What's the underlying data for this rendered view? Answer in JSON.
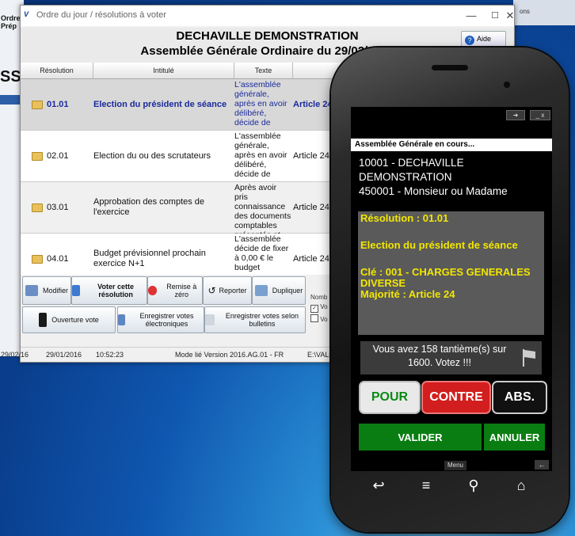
{
  "background_app": {
    "left_label1": "Ordre",
    "left_label2": "Prép",
    "left_big": "SSC",
    "top_right": "ons"
  },
  "window": {
    "title": "Ordre du jour / résolutions à voter",
    "logo": "V",
    "controls": {
      "minimize": "—",
      "maximize": "☐",
      "close": "✕"
    },
    "header_line1": "DECHAVILLE DEMONSTRATION",
    "header_line2": "Assemblée Générale Ordinaire du 29/02/2016",
    "help_label": "Aide (F1)",
    "columns": [
      "Résolution",
      "Intitulé",
      "Texte",
      "Majo"
    ],
    "rows": [
      {
        "num": "01.01",
        "title": "Election du président de séance",
        "text": "L'assemblée générale, après en avoir délibéré, décide de",
        "maj": "Article 24"
      },
      {
        "num": "02.01",
        "title": "Election du ou des scrutateurs",
        "text": "L'assemblée générale, après en avoir délibéré, décide de",
        "maj": "Article 24"
      },
      {
        "num": "03.01",
        "title": "Approbation des comptes de l'exercice",
        "text": "Après avoir pris connaissance des documents comptables présentés et",
        "maj": "Article 24"
      },
      {
        "num": "04.01",
        "title": "Budget prévisionnel prochain exercice N+1",
        "text": "L'assemblée décide de fixer à 0,00 € le budget",
        "maj": "Article 24"
      }
    ],
    "buttons": {
      "modifier": "Modifier",
      "voter": "Voter cette résolution",
      "remise": "Remise à zéro",
      "reporter": "Reporter",
      "dupliquer": "Dupliquer",
      "ouverture": "Ouverture vote",
      "enreg_elec": "Enregistrer votes électroniques",
      "enreg_bull": "Enregistrer votes selon bulletins"
    },
    "nombre_label": "Nomb",
    "check1": "Vo",
    "check2": "Vo",
    "status": {
      "d1": "29/02/16",
      "d2": "29/01/2016",
      "time": "10:52:23",
      "mode": "Mode lié  Version  2016.AG.01 - FR",
      "path": "E:\\VALO"
    }
  },
  "phone": {
    "status_btn1": "➜",
    "status_btn2": "_ x",
    "banner": "Assemblée Générale en cours...",
    "info_line1": "10001 - DECHAVILLE",
    "info_line2": "DEMONSTRATION",
    "info_line3": "450001 - Monsieur ou Madame",
    "resolution": "Résolution : 01.01",
    "resolution_title": "Election du président de séance",
    "cle": "Clé : 001 - CHARGES GENERALES DIVERSE",
    "majorite": "Majorité : Article 24",
    "votes_text": "Vous avez 158 tantième(s) sur 1600. Votez !!!",
    "pour": "POUR",
    "contre": "CONTRE",
    "abs": "ABS.",
    "valider": "VALIDER",
    "annuler": "ANNULER",
    "menu": "Menu",
    "back_small": "←",
    "nav": {
      "back": "↩",
      "menu": "≡",
      "search": "⚲",
      "home": "⌂"
    },
    "colors": {
      "pour_bg": "#e8e8e8",
      "pour_fg": "#0a8a14",
      "contre_bg": "#d21e1e",
      "abs_bg": "#111111",
      "green": "#0a7d12",
      "yellow": "#f2e700"
    }
  }
}
